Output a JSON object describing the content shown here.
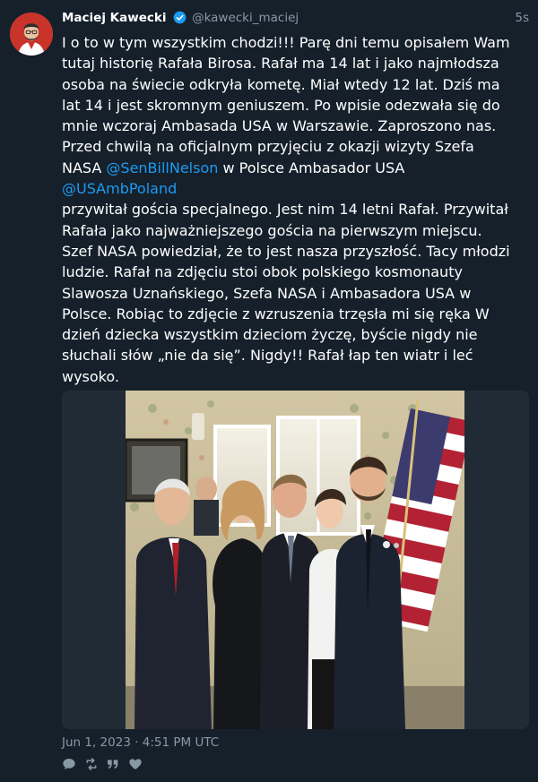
{
  "author": {
    "name": "Maciej Kawecki",
    "handle": "@kawecki_maciej",
    "time": "5s"
  },
  "tweet": {
    "lines": [
      "I o to w tym wszystkim chodzi!!! Parę dni temu opisałem Wam",
      "tutaj historię Rafała Birosa. Rafał ma 14 lat i jako najmłodsza",
      "osoba na świecie odkryła kometę. Miał wtedy 12 lat. Dziś ma",
      "lat 14 i jest skromnym geniuszem. Po wpisie odezwała się do",
      "mnie wczoraj Ambasada USA w Warszawie. Zaproszono nas.",
      "Przed chwilą na oficjalnym przyjęciu z okazji wizyty Szefa",
      "przywitał gościa specjalnego. Jest nim 14 letni Rafał. Przywitał",
      "Rafała jako najważniejszego gościa na pierwszym miejscu.",
      "Szef NASA powiedział, że to jest nasza przyszłość. Tacy młodzi",
      "ludzie. Rafał na zdjęciu stoi obok polskiego kosmonauty",
      "Slawosza Uznańskiego, Szefa NASA i Ambasadora USA w",
      "Polsce. Robiąc to zdjęcie z wzruszenia trzęsła mi się ręka     W",
      "dzień dziecka wszystkim dzieciom życzę, byście nigdy nie",
      "słuchali słów „nie da się”. Nigdy!! Rafał łap ten wiatr i leć",
      "wysoko."
    ],
    "nasa_prefix": "NASA ",
    "mention_1": "@SenBillNelson",
    "nasa_suffix": " w Polsce Ambasador USA",
    "mention_2": "@USAmbPoland"
  },
  "timestamp": "Jun 1, 2023 · 4:51 PM UTC",
  "colors": {
    "background": "#15202b",
    "link": "#1d9bf0",
    "muted": "#8899a6",
    "verified": "#1d9bf0"
  },
  "icons": [
    "reply-icon",
    "retweet-icon",
    "quote-icon",
    "like-icon"
  ]
}
